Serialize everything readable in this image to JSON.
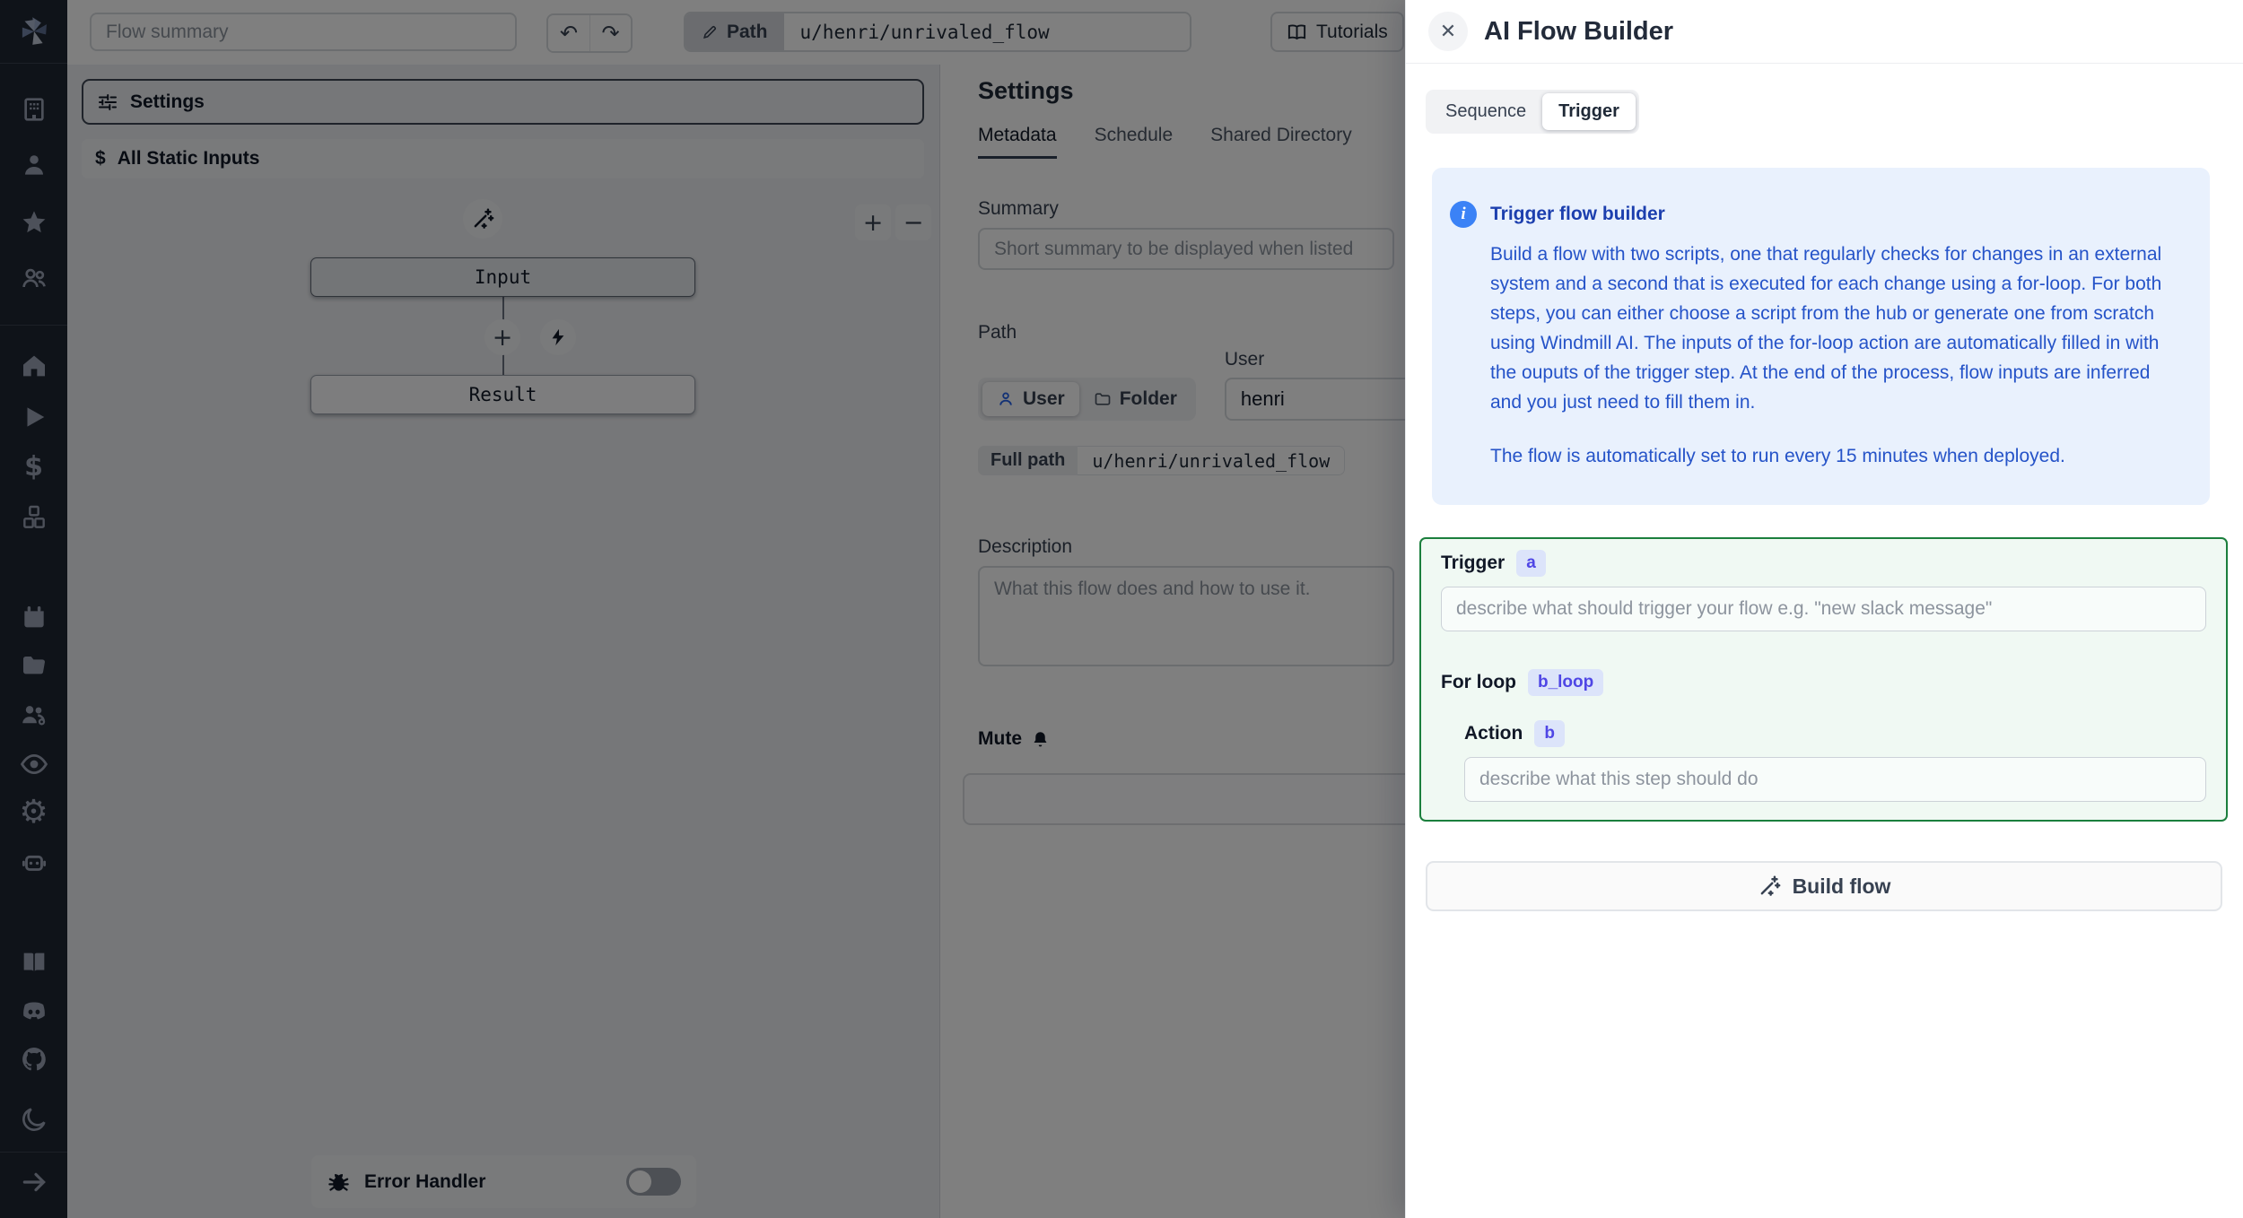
{
  "topbar": {
    "flow_summary_placeholder": "Flow summary",
    "undo_glyph": "↶",
    "redo_glyph": "↷",
    "path_label": "Path",
    "path_value": "u/henri/unrivaled_flow",
    "tutorials_label": "Tutorials"
  },
  "flow_editor": {
    "settings_button": "Settings",
    "static_inputs_button": "All Static Inputs",
    "dollar_glyph": "$",
    "input_node": "Input",
    "result_node": "Result",
    "plus_glyph": "+",
    "zoom_in_glyph": "+",
    "zoom_out_glyph": "−",
    "error_handler_label": "Error Handler",
    "error_handler_enabled": false
  },
  "settings_panel": {
    "title": "Settings",
    "tabs": {
      "metadata": "Metadata",
      "schedule": "Schedule",
      "shared_directory": "Shared Directory"
    },
    "active_tab": "Metadata",
    "summary_label": "Summary",
    "summary_placeholder": "Short summary to be displayed when listed",
    "path_label": "Path",
    "user_field_label": "User",
    "owner_toggle": {
      "user": "User",
      "folder": "Folder"
    },
    "owner_selected": "User",
    "user_value": "henri",
    "full_path_label": "Full path",
    "full_path_value": "u/henri/unrivaled_flow",
    "description_label": "Description",
    "description_placeholder": "What this flow does and how to use it.",
    "mute_label": "Mute"
  },
  "ai_panel": {
    "title": "AI Flow Builder",
    "close_glyph": "✕",
    "tabs": {
      "sequence": "Sequence",
      "trigger": "Trigger"
    },
    "active_tab": "Trigger",
    "info": {
      "icon_glyph": "i",
      "title": "Trigger flow builder",
      "body": "Build a flow with two scripts, one that regularly checks for changes in an external system and a second that is executed for each change using a for-loop. For both steps, you can either choose a script from the hub or generate one from scratch using Windmill AI. The inputs of the for-loop action are automatically filled in with the ouputs of the trigger step. At the end of the process, flow inputs are inferred and you just need to fill them in.",
      "footer": "The flow is automatically set to run every 15 minutes when deployed."
    },
    "trigger_label": "Trigger",
    "trigger_badge": "a",
    "trigger_placeholder": "describe what should trigger your flow e.g. \"new slack message\"",
    "forloop_label": "For loop",
    "forloop_badge": "b_loop",
    "action_label": "Action",
    "action_badge": "b",
    "action_placeholder": "describe what this step should do",
    "build_button_label": "Build flow"
  },
  "sidebar_icons": [
    "windmill-logo",
    "workspace",
    "user",
    "favorites",
    "groups",
    "home",
    "runs",
    "variables",
    "resources",
    "schedules",
    "folders",
    "groups-admin",
    "audit-logs",
    "settings",
    "workers",
    "docs",
    "discord",
    "github",
    "dark-mode",
    "expand"
  ],
  "colors": {
    "sidebar_bg": "#1f2633",
    "canvas_bg": "#edeff2",
    "overlay": "rgba(0,0,0,0.5)",
    "info_bg": "#e9f1fd",
    "info_text": "#2553c8",
    "trigger_border": "#1b7f3d",
    "trigger_bg": "#f0f9f3",
    "badge_bg": "#dce4fa",
    "badge_text": "#4f46e5",
    "info_icon_bg": "#3b82f6"
  }
}
